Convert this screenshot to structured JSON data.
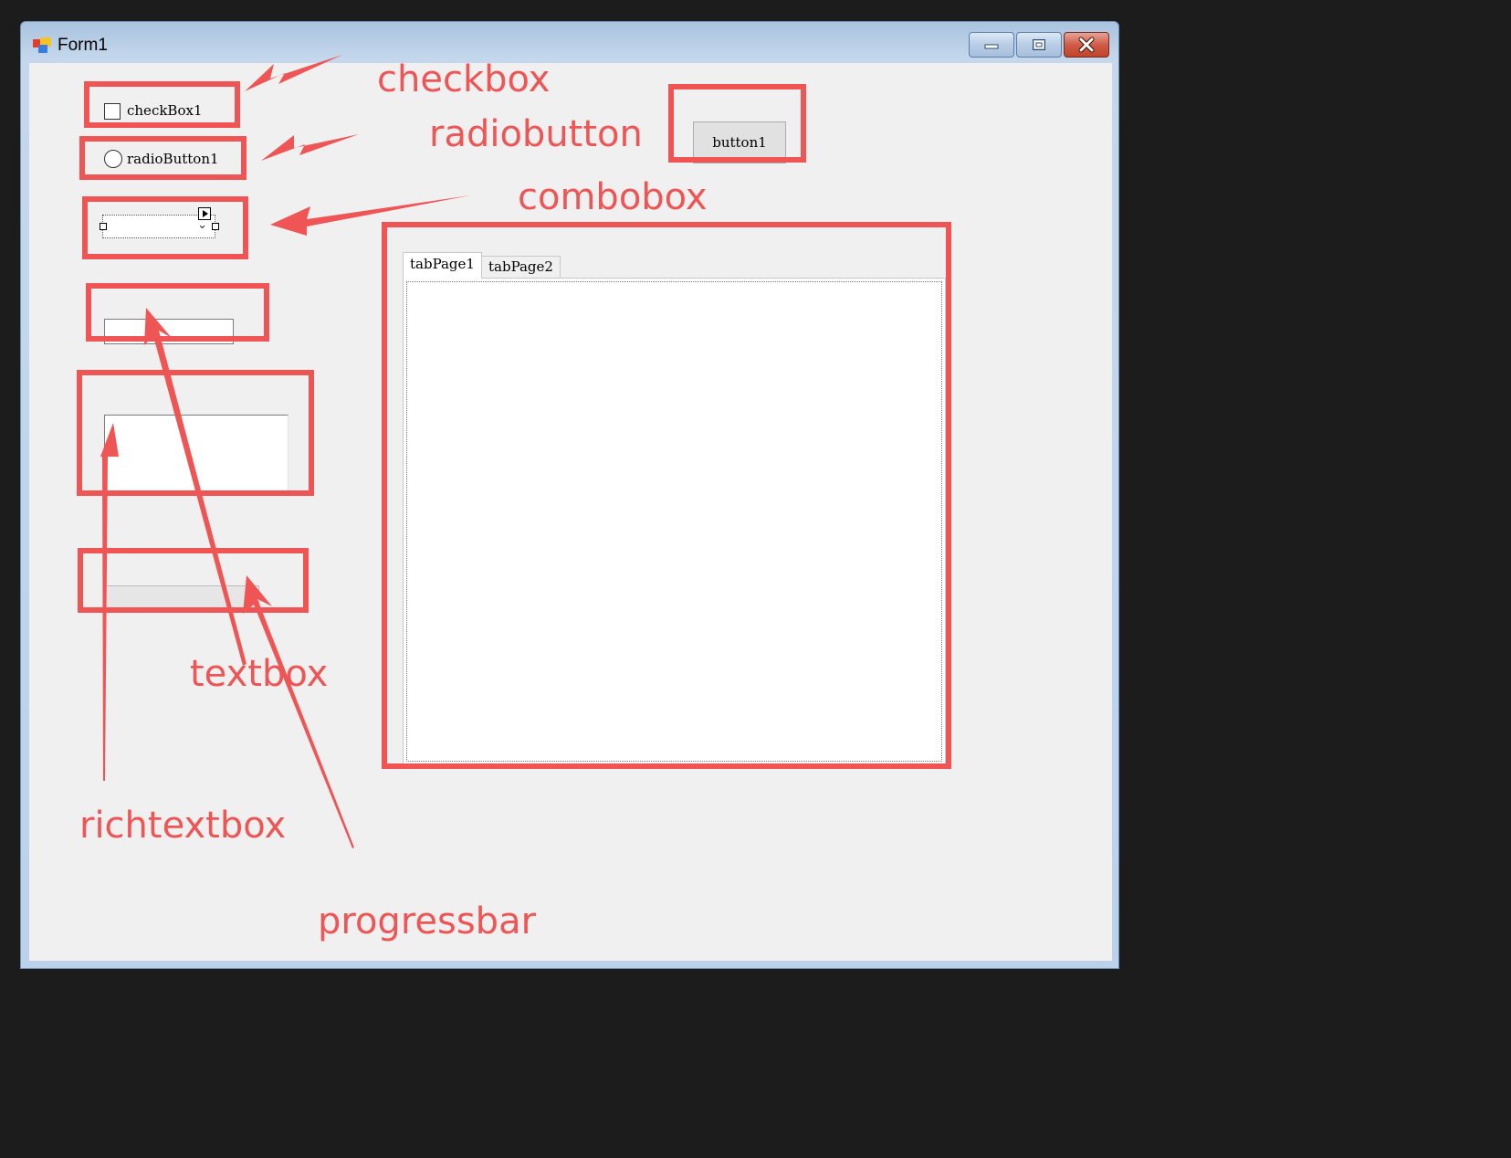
{
  "window": {
    "title": "Form1",
    "accent_color": "#c1432c",
    "buttons": [
      "minimize-icon",
      "maximize-icon",
      "close-icon"
    ]
  },
  "controls": {
    "checkbox_label": "checkBox1",
    "checkbox_checked": false,
    "radio_label": "radioButton1",
    "radio_selected": false,
    "combobox_value": "",
    "textbox_value": "",
    "richtextbox_value": "",
    "progressbar_value_percent": 0,
    "button_label": "button1",
    "tabs": [
      {
        "label": "tabPage1",
        "selected": true
      },
      {
        "label": "tabPage2",
        "selected": false
      }
    ]
  },
  "annotations": {
    "color": "#ef5555",
    "checkbox": "checkbox",
    "radiobutton": "radiobutton",
    "combobox": "combobox",
    "textbox": "textbox",
    "richtextbox": "richtextbox",
    "progressbar": "progressbar"
  }
}
